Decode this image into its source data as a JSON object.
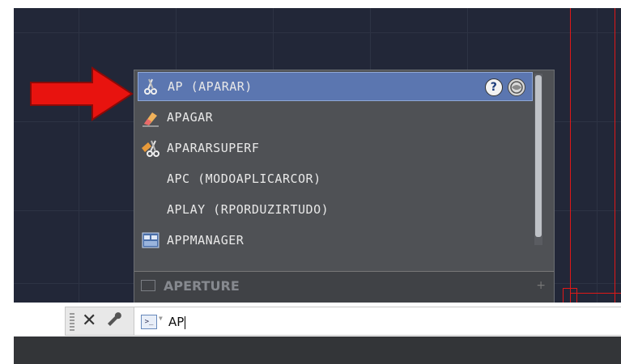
{
  "autocomplete": {
    "items": [
      {
        "label": "AP (APARAR)",
        "icon": "scissors-icon",
        "selected": true
      },
      {
        "label": "APAGAR",
        "icon": "eraser-icon"
      },
      {
        "label": "APARARSUPERF",
        "icon": "surface-trim-icon"
      },
      {
        "label": "APC (MODOAPLICARCOR)",
        "icon": ""
      },
      {
        "label": "APLAY (RPORDUZIRTUDO)",
        "icon": ""
      },
      {
        "label": "APPMANAGER",
        "icon": "app-manager-icon"
      }
    ],
    "help_icon_glyph": "?",
    "system_variable": {
      "label": "APERTURE",
      "expand_glyph": "+"
    }
  },
  "command_line": {
    "close_glyph": "✕",
    "input_value": "AP"
  },
  "colors": {
    "canvas": "#222738",
    "selection": "#5b76b0",
    "arrow": "#e8130f",
    "boundary_line": "#e01818"
  }
}
